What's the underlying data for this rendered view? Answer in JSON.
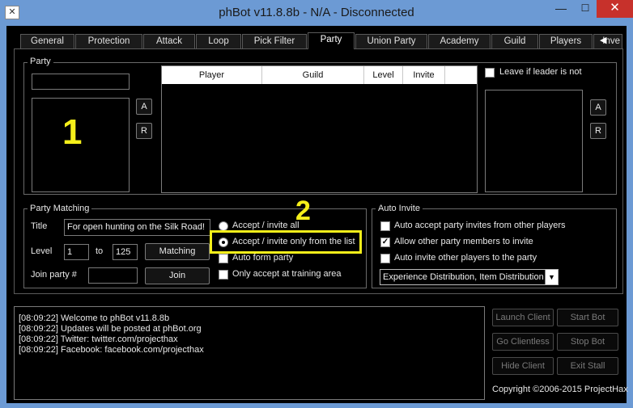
{
  "window": {
    "title": "phBot v11.8.8b - N/A - Disconnected",
    "app_icon": "app-icon",
    "controls": {
      "minimize": "—",
      "maximize": "☐",
      "close": "✕"
    }
  },
  "tabs": [
    {
      "label": "General",
      "active": false
    },
    {
      "label": "Protection",
      "active": false
    },
    {
      "label": "Attack",
      "active": false
    },
    {
      "label": "Loop",
      "active": false
    },
    {
      "label": "Pick Filter",
      "active": false
    },
    {
      "label": "Party",
      "active": true
    },
    {
      "label": "Union Party",
      "active": false
    },
    {
      "label": "Academy",
      "active": false
    },
    {
      "label": "Guild",
      "active": false
    },
    {
      "label": "Players",
      "active": false
    },
    {
      "label": "Inve",
      "active": false
    }
  ],
  "tab_scroll": {
    "left": "◀",
    "right": "▶"
  },
  "party": {
    "group_label": "Party",
    "name_value": "",
    "add_label": "A",
    "remove_label": "R",
    "table_headers": [
      "Player",
      "Guild",
      "Level",
      "Invite"
    ],
    "leave_if_leader_label": "Leave if leader is not",
    "leave_if_leader_checked": false,
    "right_add_label": "A",
    "right_remove_label": "R"
  },
  "party_matching": {
    "group_label": "Party Matching",
    "title_label": "Title",
    "title_value": "For open hunting on the Silk Road!",
    "level_label": "Level",
    "level_from": "1",
    "to_label": "to",
    "level_to": "125",
    "matching_button": "Matching",
    "join_party_label": "Join party #",
    "join_party_value": "",
    "join_button": "Join",
    "options": [
      {
        "label": "Accept / invite all",
        "type": "radio",
        "checked": false
      },
      {
        "label": "Accept / invite only from the list",
        "type": "radio",
        "checked": true
      },
      {
        "label": "Auto form party",
        "type": "checkbox",
        "checked": false
      },
      {
        "label": "Only accept at training area",
        "type": "checkbox",
        "checked": false
      }
    ]
  },
  "auto_invite": {
    "group_label": "Auto Invite",
    "options": [
      {
        "label": "Auto accept party invites from other players",
        "checked": false
      },
      {
        "label": "Allow other party members to invite",
        "checked": true
      },
      {
        "label": "Auto invite other players to the party",
        "checked": false
      }
    ],
    "distribution_value": "Experience Distribution, Item Distribution"
  },
  "log": {
    "lines": [
      "[08:09:22] Welcome to phBot v11.8.8b",
      "[08:09:22] Updates will be posted at phBot.org",
      "[08:09:22] Twitter: twitter.com/projecthax",
      "[08:09:22] Facebook: facebook.com/projecthax"
    ]
  },
  "bot_controls": {
    "launch_client": "Launch Client",
    "start_bot": "Start Bot",
    "go_clientless": "Go Clientless",
    "stop_bot": "Stop Bot",
    "hide_client": "Hide Client",
    "exit_stall": "Exit Stall"
  },
  "copyright": "Copyright ©2006-2015 ProjectHax",
  "annotations": {
    "one": "1",
    "two": "2"
  },
  "colors": {
    "titlebar": "#6c9ad4",
    "close_button": "#c7312b",
    "annotation": "#f5ef1a",
    "background": "#000000"
  }
}
